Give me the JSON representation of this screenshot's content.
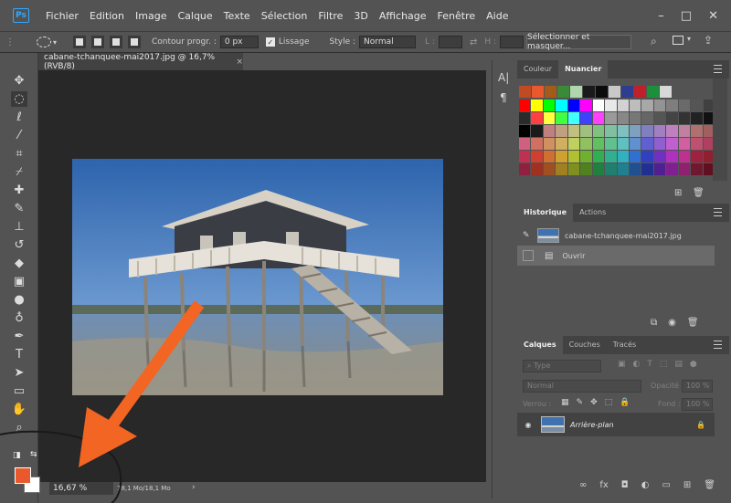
{
  "app": {
    "logo": "Ps"
  },
  "menu": [
    "Fichier",
    "Edition",
    "Image",
    "Calque",
    "Texte",
    "Sélection",
    "Filtre",
    "3D",
    "Affichage",
    "Fenêtre",
    "Aide"
  ],
  "window_controls": {
    "minimize": "–",
    "maximize": "□",
    "close": "✕"
  },
  "options": {
    "feather_label": "Contour progr. :",
    "feather_value": "0 px",
    "antialias_label": "Lissage",
    "style_label": "Style :",
    "style_value": "Normal",
    "width_label": "L :",
    "height_label": "H :",
    "select_mask_button": "Sélectionner et masquer..."
  },
  "document": {
    "tab_title": "cabane-tchanquee-mai2017.jpg @ 16,7% (RVB/8)",
    "tab_close": "×",
    "zoom": "16,67 %",
    "doc_size": "18,1 Mo/18,1 Mo"
  },
  "colors_panel": {
    "tabs": [
      "Couleur",
      "Nuancier"
    ],
    "active_tab": 1,
    "recent_swatches": [
      "#c04a22",
      "#e9592d",
      "#a35b1a",
      "#3b8a3a",
      "#b0d6b0",
      "#1a1a1a",
      "#0b0b0b",
      "#c8c8c8",
      "#2d3e8f",
      "#c0202a",
      "#1c8f3a",
      "#d8d8d8"
    ],
    "grid": [
      [
        "#ff0000",
        "#ffff00",
        "#00ff00",
        "#00ffff",
        "#0000ff",
        "#ff00ff",
        "#ffffff",
        "#e8e8e8",
        "#d2d2d2",
        "#bdbdbd",
        "#a8a8a8",
        "#939393",
        "#7e7e7e",
        "#6a6a6a",
        "#555555",
        "#404040"
      ],
      [
        "#2b2b2b",
        "#ff4040",
        "#ffff40",
        "#40ff40",
        "#40ffff",
        "#4040ff",
        "#ff40ff",
        "#9a9a9a",
        "#888888",
        "#777777",
        "#666666",
        "#555555",
        "#444444",
        "#333333",
        "#222222",
        "#111111"
      ],
      [
        "#000000",
        "#1a1a1a",
        "#c08080",
        "#c0a080",
        "#c0c080",
        "#a0c080",
        "#80c080",
        "#80c0a0",
        "#80c0c0",
        "#80a0c0",
        "#8080c0",
        "#a080c0",
        "#c080c0",
        "#c080a0",
        "#b07070",
        "#a06060"
      ],
      [
        "#d06080",
        "#d07060",
        "#d09060",
        "#d0b060",
        "#c0d060",
        "#90c060",
        "#60c060",
        "#60c090",
        "#60c0c0",
        "#6090d0",
        "#6060d0",
        "#9060d0",
        "#c060d0",
        "#d060a0",
        "#c05070",
        "#b04060"
      ],
      [
        "#c03050",
        "#d04030",
        "#d07030",
        "#d0a030",
        "#b0c030",
        "#70b030",
        "#30b050",
        "#30b090",
        "#30b0c0",
        "#3070d0",
        "#3040c0",
        "#7030c0",
        "#b030c0",
        "#c03090",
        "#a02040",
        "#902030"
      ],
      [
        "#902040",
        "#a03020",
        "#a05020",
        "#a08020",
        "#809020",
        "#508020",
        "#208040",
        "#208070",
        "#208090",
        "#205090",
        "#203090",
        "#502090",
        "#802090",
        "#902070",
        "#701830",
        "#601020"
      ]
    ]
  },
  "history_panel": {
    "tabs": [
      "Historique",
      "Actions"
    ],
    "snapshot": "cabane-tchanquee-mai2017.jpg",
    "items": [
      "Ouvrir"
    ]
  },
  "layers_panel": {
    "tabs": [
      "Calques",
      "Couches",
      "Tracés"
    ],
    "filter_placeholder": "Type",
    "blend_mode": "Normal",
    "opacity_label": "Opacité :",
    "opacity_value": "100 %",
    "lock_label": "Verrou :",
    "fill_label": "Fond :",
    "fill_value": "100 %",
    "layers": [
      {
        "name": "Arrière-plan"
      }
    ]
  },
  "icons": {
    "toolbar": [
      "move-icon",
      "marquee-ellipse-icon",
      "lasso-icon",
      "magic-wand-icon",
      "crop-icon",
      "eyedropper-icon",
      "healing-brush-icon",
      "brush-icon",
      "clone-stamp-icon",
      "history-brush-icon",
      "eraser-icon",
      "gradient-icon",
      "blur-icon",
      "dodge-icon",
      "pen-icon",
      "type-icon",
      "path-selection-icon",
      "rectangle-shape-icon",
      "hand-icon",
      "zoom-icon"
    ]
  },
  "foreground_color": "#e9592d",
  "background_color": "#ffffff",
  "annotation_color": "#f26522"
}
